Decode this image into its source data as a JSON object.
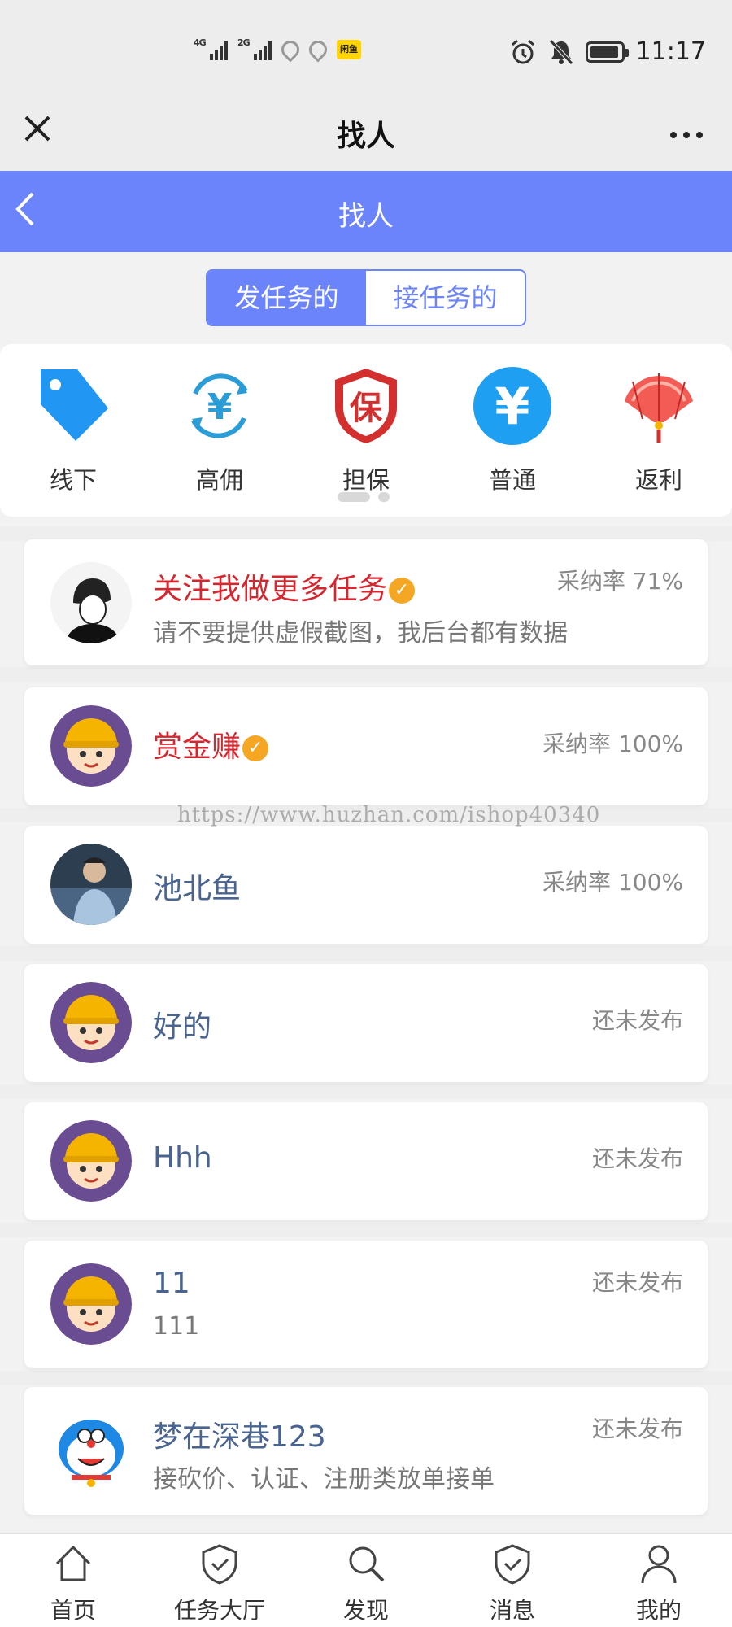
{
  "status_bar": {
    "signal1": "4G",
    "signal2": "2G",
    "app_badge": "闲鱼",
    "time": "11:17"
  },
  "window": {
    "title": "找人",
    "close_icon": "close-icon",
    "more_icon": "more-icon"
  },
  "nav": {
    "title": "找人",
    "back_icon": "back-icon",
    "color": "#6c84fb"
  },
  "tabs": [
    {
      "label": "发任务的",
      "active": true
    },
    {
      "label": "接任务的",
      "active": false
    }
  ],
  "categories": [
    {
      "label": "线下",
      "icon": "tag-icon"
    },
    {
      "label": "高佣",
      "icon": "yuan-cycle-icon"
    },
    {
      "label": "担保",
      "icon": "guarantee-shield-icon"
    },
    {
      "label": "普通",
      "icon": "yuan-circle-icon"
    },
    {
      "label": "返利",
      "icon": "fan-icon"
    }
  ],
  "users": [
    {
      "name": "关注我做更多任务",
      "verified": true,
      "highlight": true,
      "desc": "请不要提供虚假截图，我后台都有数据",
      "rate": "采纳率 71%",
      "avatar": "sketch-avatar"
    },
    {
      "name": "赏金赚",
      "verified": true,
      "highlight": true,
      "desc": "",
      "rate": "采纳率 100%",
      "avatar": "cartoon-boy-avatar"
    },
    {
      "name": "池北鱼",
      "verified": false,
      "highlight": false,
      "desc": "",
      "rate": "采纳率 100%",
      "avatar": "photo-avatar"
    },
    {
      "name": "好的",
      "verified": false,
      "highlight": false,
      "desc": "",
      "rate": "还未发布",
      "avatar": "cartoon-boy-avatar"
    },
    {
      "name": "Hhh",
      "verified": false,
      "highlight": false,
      "desc": "",
      "rate": "还未发布",
      "avatar": "cartoon-boy-avatar"
    },
    {
      "name": "11",
      "verified": false,
      "highlight": false,
      "desc": "111",
      "rate": "还未发布",
      "avatar": "cartoon-boy-avatar"
    },
    {
      "name": "梦在深巷123",
      "verified": false,
      "highlight": false,
      "desc": "接砍价、认证、注册类放单接单",
      "rate": "还未发布",
      "avatar": "doraemon-avatar"
    }
  ],
  "watermark": "https://www.huzhan.com/ishop40340",
  "bottom_tabs": [
    {
      "label": "首页",
      "icon": "home-icon"
    },
    {
      "label": "任务大厅",
      "icon": "shield-check-icon"
    },
    {
      "label": "发现",
      "icon": "search-icon"
    },
    {
      "label": "消息",
      "icon": "shield-check-icon"
    },
    {
      "label": "我的",
      "icon": "user-icon"
    }
  ]
}
